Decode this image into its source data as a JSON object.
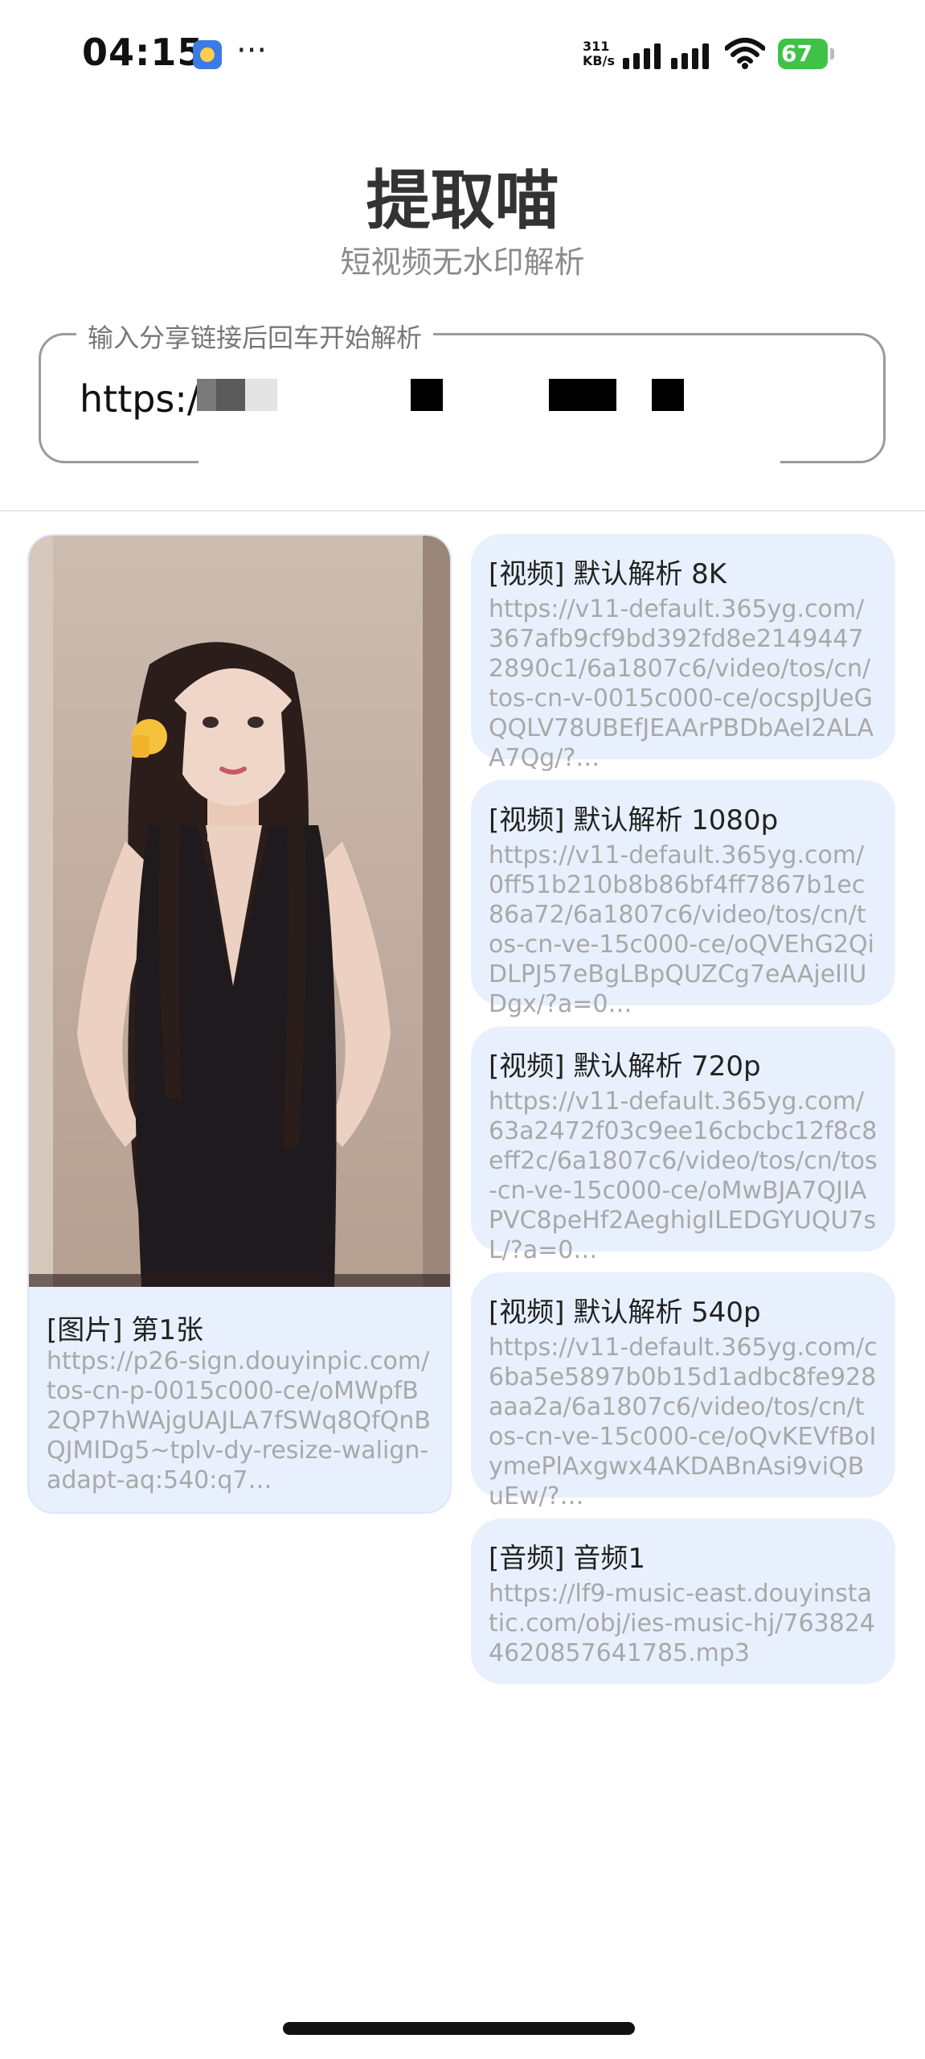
{
  "status_bar": {
    "time": "04:15",
    "more": "···",
    "net_speed_value": "311",
    "net_speed_unit": "KB/s",
    "battery": "67",
    "icons": [
      "app-icon",
      "signal-icon",
      "wifi-icon",
      "battery-charging-icon"
    ]
  },
  "header": {
    "title": "提取喵",
    "subtitle": "短视频无水印解析"
  },
  "input": {
    "label": "输入分享链接后回车开始解析",
    "value": "https:/"
  },
  "image_result": {
    "title": "[图片] 第1张",
    "url": "https://p26-sign.douyinpic.com/tos-cn-p-0015c000-ce/oMWpfB2QP7hWAjgUAJLA7fSWq8QfQnBQJMIDg5~tplv-dy-resize-walign-adapt-aq:540:q7…"
  },
  "video_results": [
    {
      "title": "[视频] 默认解析 8K",
      "url": "https://v11-default.365yg.com/367afb9cf9bd392fd8e21494472890c1/6a1807c6/video/tos/cn/tos-cn-v-0015c000-ce/ocspJUeGQQLV78UBEfJEAArPBDbAeI2ALAA7Qg/?…"
    },
    {
      "title": "[视频] 默认解析 1080p",
      "url": "https://v11-default.365yg.com/0ff51b210b8b86bf4ff7867b1ec86a72/6a1807c6/video/tos/cn/tos-cn-ve-15c000-ce/oQVEhG2QiDLPJ57eBgLBpQUZCg7eAAjeIlUDgx/?a=0…"
    },
    {
      "title": "[视频] 默认解析 720p",
      "url": "https://v11-default.365yg.com/63a2472f03c9ee16cbcbc12f8c8eff2c/6a1807c6/video/tos/cn/tos-cn-ve-15c000-ce/oMwBJA7QJIAPVC8peHf2AeghigILEDGYUQU7sL/?a=0…"
    },
    {
      "title": "[视频] 默认解析 540p",
      "url": "https://v11-default.365yg.com/c6ba5e5897b0b15d1adbc8fe928aaa2a/6a1807c6/video/tos/cn/tos-cn-ve-15c000-ce/oQvKEVfBoIymePlAxgwx4AKDABnAsi9viQBuEw/?…"
    }
  ],
  "audio_result": {
    "title": "[音频] 音频1",
    "url": "https://lf9-music-east.douyinstatic.com/obj/ies-music-hj/7638244620857641785.mp3"
  },
  "colors": {
    "card_bg": "#e8f0fd",
    "url_text": "#a8a8a8",
    "battery": "#3fc247"
  }
}
